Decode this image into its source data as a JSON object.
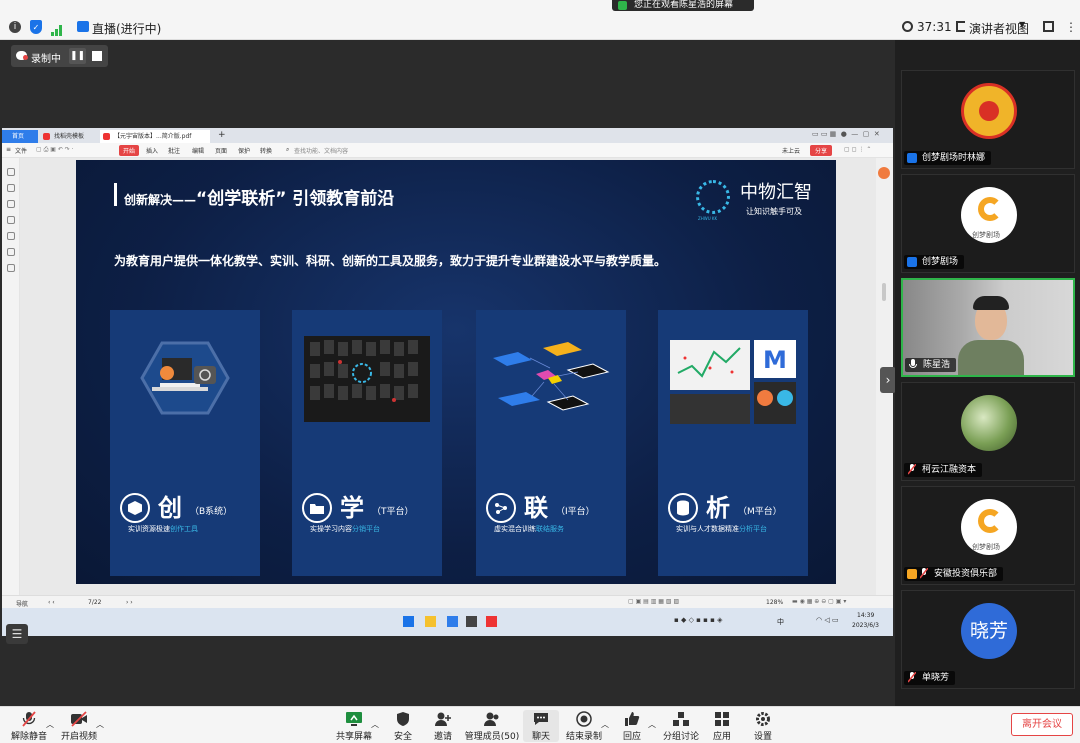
{
  "topbar": {
    "live_label": "直播(进行中)",
    "timer": "37:31",
    "view_label": "演讲者视图",
    "share_banner": "您正在观看陈星浩的屏幕"
  },
  "recording": {
    "label": "录制中"
  },
  "shared_screen": {
    "tabs": [
      "首页",
      "找稻壳模板",
      "【元宇宙版本】...简介版.pdf"
    ],
    "toolbar": {
      "file_menu": "文件",
      "home_tab": "开始",
      "items": [
        "插入",
        "批注",
        "编辑",
        "页面",
        "保护",
        "转换"
      ],
      "search": "查找功能、文档内容",
      "unsaved": "未上云",
      "share": "分享"
    },
    "statusbar": {
      "nav": "导航",
      "page": "7/22",
      "zoom": "128%"
    },
    "taskbar": {
      "time": "14:39",
      "date": "2023/6/3",
      "lang": "中"
    },
    "slide": {
      "title_prefix": "创新解决——",
      "title_main": "“创学联析”  引领教育前沿",
      "brand_name": "中物汇智",
      "brand_slogan": "让知识触手可及",
      "brand_small": "ZHWU KK",
      "subtitle": "为教育用户提供一体化教学、实训、科研、创新的工具及服务，致力于提升专业群建设水平与教学质量。",
      "cards": [
        {
          "big": "创",
          "tag": "（B系统）",
          "desc": "实训资源极速",
          "accent": "创作工具"
        },
        {
          "big": "学",
          "tag": "（T平台）",
          "desc": "实操学习内容",
          "accent": "分销平台"
        },
        {
          "big": "联",
          "tag": "（I平台）",
          "desc": "虚实混合训练",
          "accent": "联结服务"
        },
        {
          "big": "析",
          "tag": "（M平台）",
          "desc": "实训与人才数据精准",
          "accent": "分析平台"
        }
      ]
    }
  },
  "participants": [
    {
      "name": "创梦剧场时林娜",
      "avatar_text": ""
    },
    {
      "name": "创梦剧场",
      "avatar_text": "创梦剧场"
    },
    {
      "name": "陈星浩",
      "avatar_text": ""
    },
    {
      "name": "柯云江融资本",
      "avatar_text": ""
    },
    {
      "name": "安徽投资俱乐部",
      "avatar_text": "创梦剧场"
    },
    {
      "name": "单晓芳",
      "avatar_text": "晓芳"
    }
  ],
  "bottombar": {
    "mute": "解除静音",
    "video": "开启视频",
    "share": "共享屏幕",
    "security": "安全",
    "invite": "邀请",
    "members": "管理成员(50)",
    "chat": "聊天",
    "end_record": "结束录制",
    "reaction": "回应",
    "breakout": "分组讨论",
    "apps": "应用",
    "settings": "设置",
    "leave": "离开会议"
  },
  "colors": {
    "accent": "#39b8e6",
    "leave": "#e54545",
    "active_speaker": "#2fb54a",
    "card": "#163a77"
  }
}
